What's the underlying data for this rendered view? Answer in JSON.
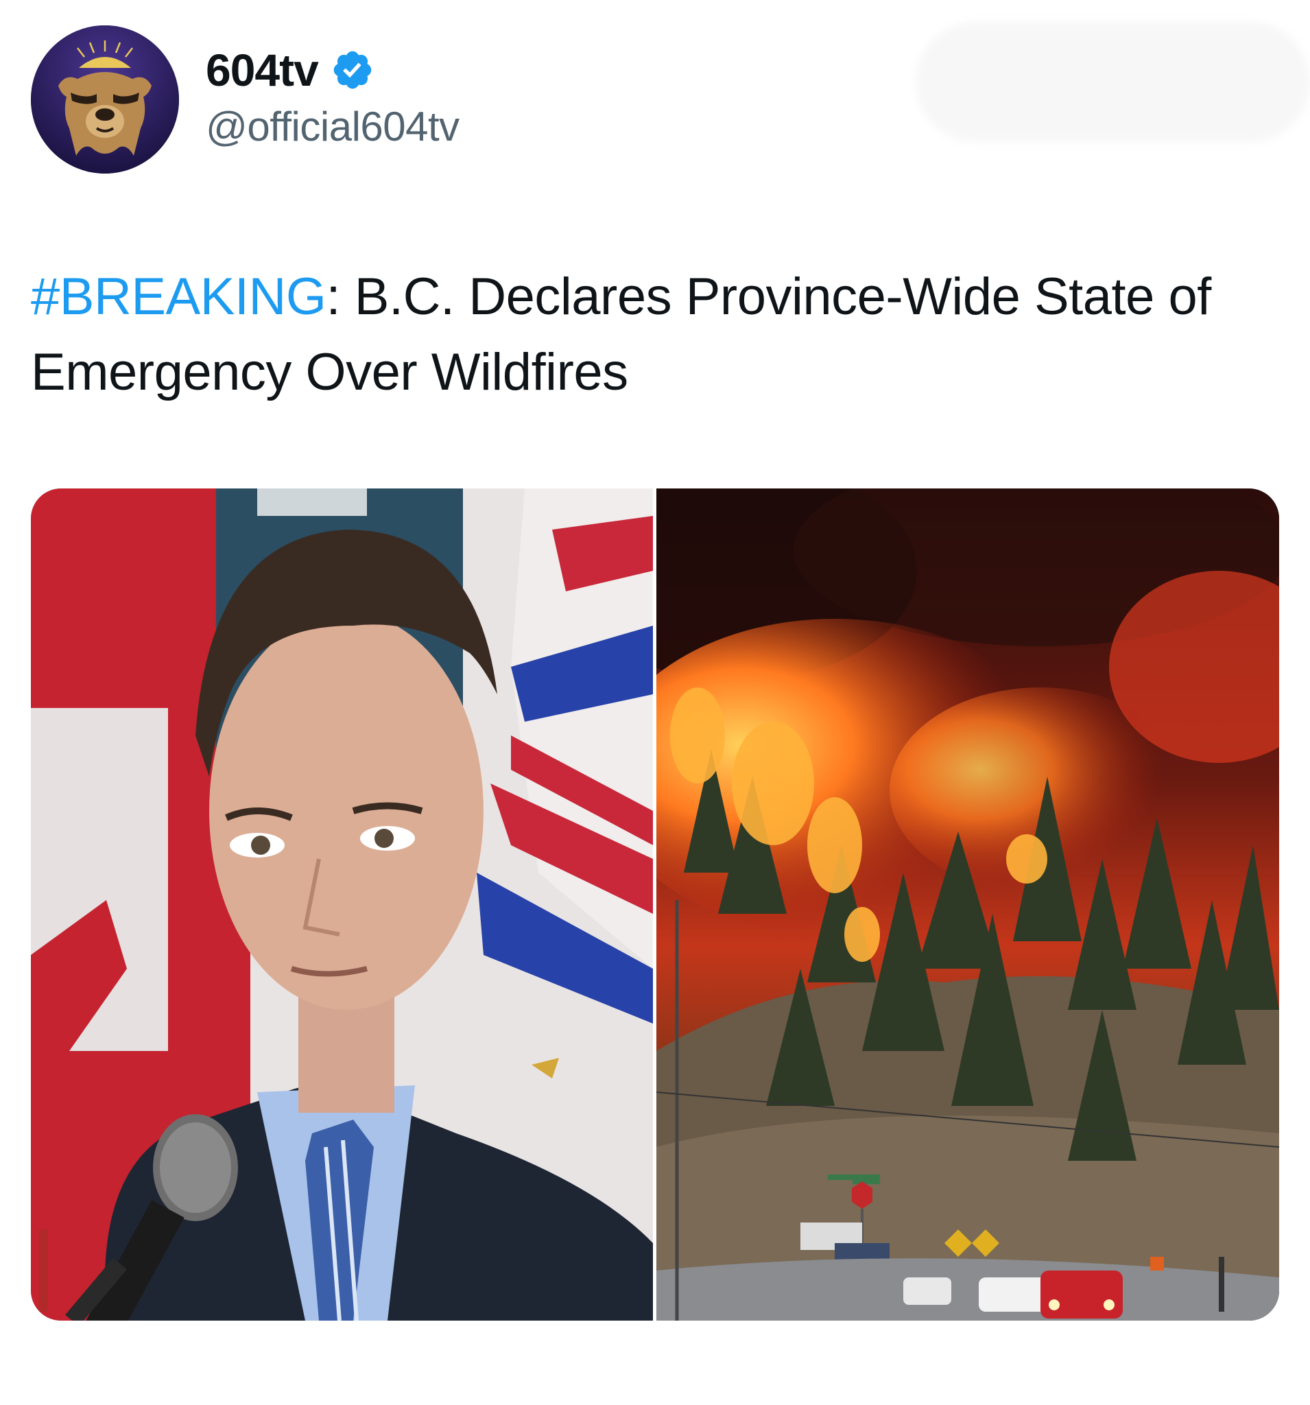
{
  "post": {
    "author": {
      "display_name": "604tv",
      "handle": "@official604tv",
      "verified": true,
      "avatar_icon": "bear-sunrise-logo-icon"
    },
    "text": {
      "hashtag": "#BREAKING",
      "colon": ":",
      "body": " B.C. Declares Province-Wide State of Emergency Over Wildfires"
    },
    "media": {
      "left_image": "premier-at-podium-photo",
      "right_image": "wildfire-on-hillside-photo"
    }
  },
  "colors": {
    "hashtag": "#1d9bf0",
    "text": "#0f1419",
    "secondary": "#536471",
    "verified": "#1d9bf0"
  }
}
